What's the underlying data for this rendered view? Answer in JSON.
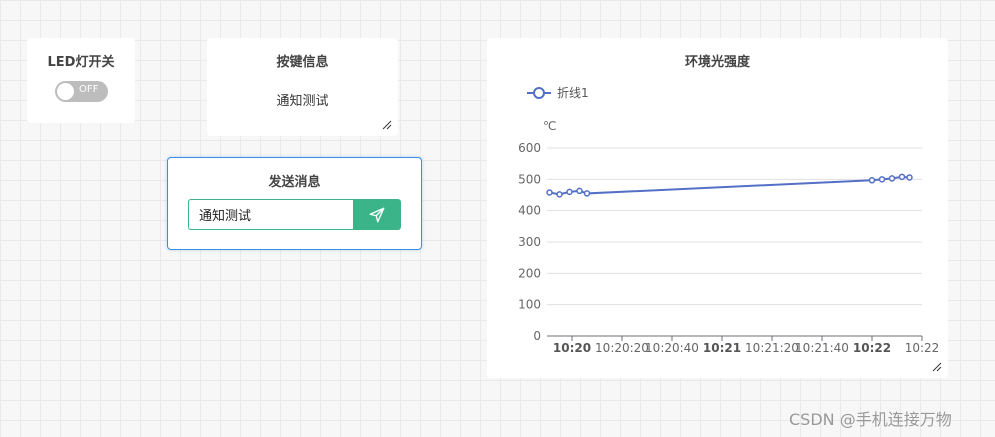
{
  "led_card": {
    "title": "LED灯开关",
    "toggle_text": "OFF",
    "toggle_on": false
  },
  "key_card": {
    "title": "按键信息",
    "message": "通知测试"
  },
  "send_card": {
    "title": "发送消息",
    "input_value": "通知测试",
    "button_icon": "send-icon",
    "accent": "#3cb48a"
  },
  "chart_card": {
    "title": "环境光强度"
  },
  "chart_data": {
    "type": "line",
    "title": "环境光强度",
    "xlabel": "",
    "ylabel": "℃",
    "ylim": [
      0,
      600
    ],
    "yticks": [
      0,
      100,
      200,
      300,
      400,
      500,
      600
    ],
    "xlim": [
      "10:19:50",
      "10:22"
    ],
    "xticks": [
      {
        "label": "10:20",
        "t": "10:20:00",
        "bold": true
      },
      {
        "label": "10:20:20",
        "t": "10:20:20",
        "bold": false
      },
      {
        "label": "10:20:40",
        "t": "10:20:40",
        "bold": false
      },
      {
        "label": "10:21",
        "t": "10:21:00",
        "bold": true
      },
      {
        "label": "10:21:20",
        "t": "10:21:20",
        "bold": false
      },
      {
        "label": "10:21:40",
        "t": "10:21:40",
        "bold": false
      },
      {
        "label": "10:22",
        "t": "10:22:00",
        "bold": true
      },
      {
        "label": "10:22",
        "t": "10:22:20",
        "bold": false
      }
    ],
    "grid": true,
    "legend_position": "top-left",
    "color": "#5470c6",
    "series": [
      {
        "name": "折线1",
        "x": [
          "10:19:51",
          "10:19:55",
          "10:19:59",
          "10:20:03",
          "10:20:06",
          "10:22:00",
          "10:22:04",
          "10:22:08",
          "10:22:12",
          "10:22:15"
        ],
        "values": [
          458,
          452,
          460,
          463,
          455,
          497,
          500,
          503,
          508,
          506
        ]
      }
    ]
  },
  "watermark": "CSDN @手机连接万物"
}
